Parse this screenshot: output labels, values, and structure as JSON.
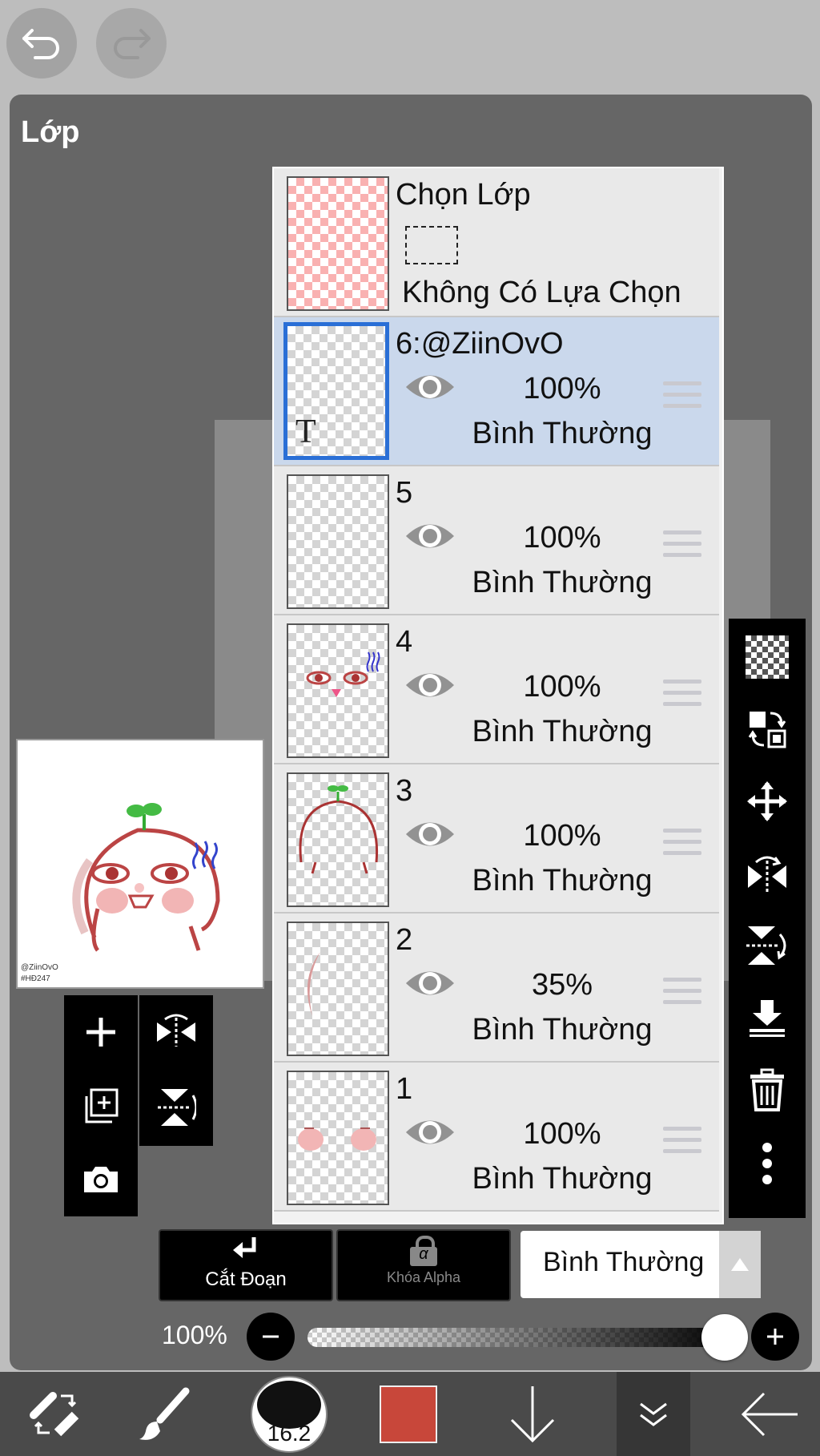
{
  "panel": {
    "title": "Lớp"
  },
  "selection_row": {
    "title": "Chọn Lớp",
    "status": "Không Có Lựa Chọn"
  },
  "layers": [
    {
      "name": "6:@ZiinOvO",
      "opacity": "100%",
      "blend": "Bình Thường",
      "selected": true,
      "type": "text",
      "type_glyph": "T"
    },
    {
      "name": "5",
      "opacity": "100%",
      "blend": "Bình Thường",
      "selected": false
    },
    {
      "name": "4",
      "opacity": "100%",
      "blend": "Bình Thường",
      "selected": false
    },
    {
      "name": "3",
      "opacity": "100%",
      "blend": "Bình Thường",
      "selected": false
    },
    {
      "name": "2",
      "opacity": "35%",
      "blend": "Bình Thường",
      "selected": false
    },
    {
      "name": "1",
      "opacity": "100%",
      "blend": "Bình Thường",
      "selected": false
    }
  ],
  "preview": {
    "watermark_line1": "@ZiinOvO",
    "watermark_line2": "#HĐ247"
  },
  "controls": {
    "clip_label": "Cắt Đoạn",
    "alpha_lock_label": "Khóa Alpha",
    "alpha_glyph": "α",
    "blend_mode": "Bình Thường",
    "opacity_label": "100%",
    "opacity_value": 1.0
  },
  "bottom_bar": {
    "brush_size": "16.2",
    "current_color": "#c8473a"
  },
  "icons": {
    "top": [
      "undo-icon",
      "redo-icon"
    ],
    "right_toolbar": [
      "transparency-icon",
      "move-layer-content-icon",
      "move-icon",
      "flip-horizontal-icon",
      "flip-vertical-icon",
      "merge-down-icon",
      "delete-icon",
      "more-icon"
    ],
    "left_tools": [
      "add-layer-icon",
      "flip-horizontal-icon",
      "duplicate-layer-icon",
      "flip-vertical-icon",
      "camera-icon"
    ],
    "bottom": [
      "tool-switch-icon",
      "brush-icon",
      "brush-size-icon",
      "color-swatch",
      "down-arrow-icon",
      "collapse-icon",
      "back-icon"
    ]
  }
}
